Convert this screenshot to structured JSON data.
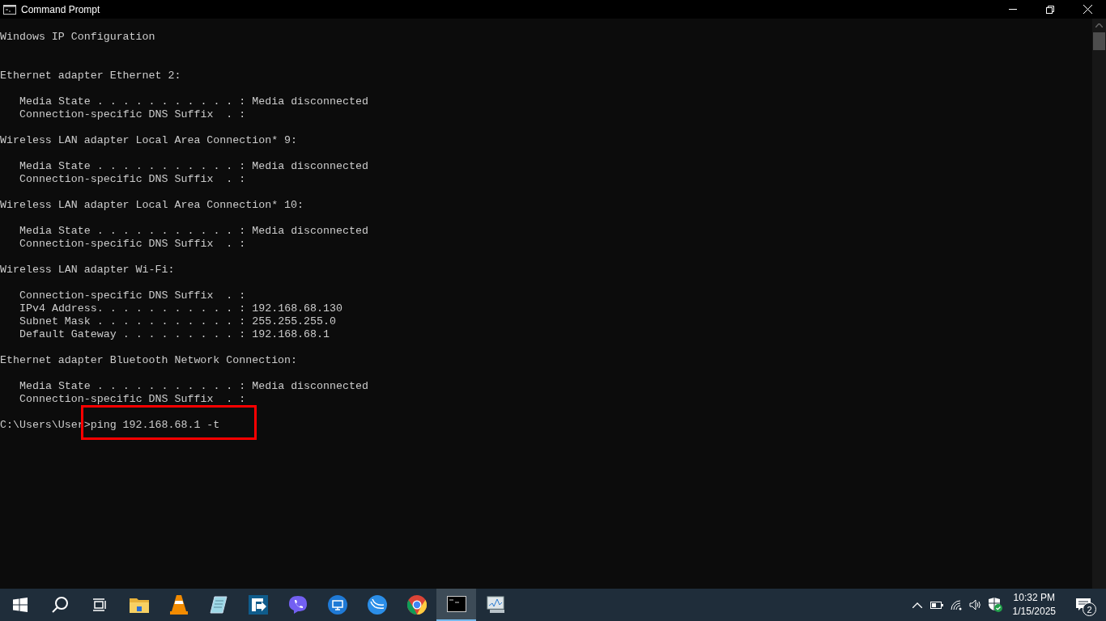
{
  "window": {
    "title": "Command Prompt"
  },
  "console": {
    "sections": [
      {
        "heading": "Windows IP Configuration"
      },
      {
        "heading": "Ethernet adapter Ethernet 2:",
        "entries": [
          "Media State . . . . . . . . . . . : Media disconnected",
          "Connection-specific DNS Suffix  . :"
        ]
      },
      {
        "heading": "Wireless LAN adapter Local Area Connection* 9:",
        "entries": [
          "Media State . . . . . . . . . . . : Media disconnected",
          "Connection-specific DNS Suffix  . :"
        ]
      },
      {
        "heading": "Wireless LAN adapter Local Area Connection* 10:",
        "entries": [
          "Media State . . . . . . . . . . . : Media disconnected",
          "Connection-specific DNS Suffix  . :"
        ]
      },
      {
        "heading": "Wireless LAN adapter Wi-Fi:",
        "entries": [
          "Connection-specific DNS Suffix  . :",
          "IPv4 Address. . . . . . . . . . . : 192.168.68.130",
          "Subnet Mask . . . . . . . . . . . : 255.255.255.0",
          "Default Gateway . . . . . . . . . : 192.168.68.1"
        ]
      },
      {
        "heading": "Ethernet adapter Bluetooth Network Connection:",
        "entries": [
          "Media State . . . . . . . . . . . : Media disconnected",
          "Connection-specific DNS Suffix  . :"
        ]
      }
    ],
    "prompt": "C:\\Users\\User>",
    "command": "ping 192.168.68.1 -t",
    "command_highlighted": true
  },
  "taskbar": {
    "items": [
      {
        "kind": "start",
        "selected": false
      },
      {
        "kind": "search",
        "selected": false
      },
      {
        "kind": "taskview",
        "selected": false
      },
      {
        "kind": "folder",
        "selected": false
      },
      {
        "kind": "cone",
        "selected": false
      },
      {
        "kind": "notepad",
        "selected": false
      },
      {
        "kind": "arrowapp",
        "selected": false
      },
      {
        "kind": "phone",
        "selected": false
      },
      {
        "kind": "monitor",
        "selected": false
      },
      {
        "kind": "waves",
        "selected": false
      },
      {
        "kind": "browser",
        "selected": false
      },
      {
        "kind": "terminal",
        "selected": true
      },
      {
        "kind": "chart",
        "selected": false
      }
    ],
    "clock_time": "10:32 PM",
    "clock_date": "1/15/2025",
    "notification_count": "2"
  }
}
